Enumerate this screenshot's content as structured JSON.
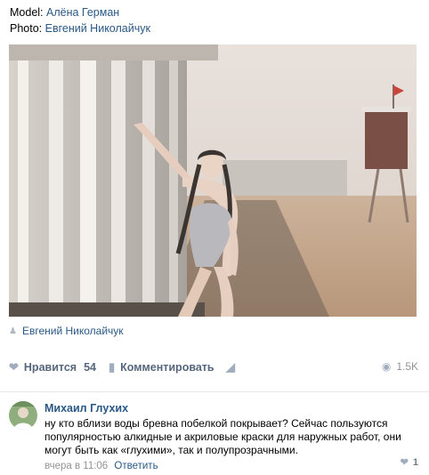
{
  "caption": {
    "model_label": "Model:",
    "model_value": "Алёна Герман",
    "photo_label": "Photo:",
    "photo_value": "Евгений Николайчук"
  },
  "photo_author": "Евгений Николайчук",
  "actions": {
    "like_label": "Нравится",
    "like_count": "54",
    "comment_label": "Комментировать",
    "views": "1.5K"
  },
  "comment": {
    "author": "Михаил Глухих",
    "text": "ну кто вблизи воды бревна побелкой покрывает? Сейчас пользуются популярностью алкидные и акриловые краски для наружных работ, они могут быть как «глухими», так и полупрозрачными.",
    "time": "вчера в 11:06",
    "reply_label": "Ответить",
    "likes": "1"
  },
  "colors": {
    "link": "#2a5885",
    "muted": "#939393",
    "icon": "#a0adbd"
  },
  "icons": [
    "person-icon",
    "heart-icon",
    "comment-icon",
    "share-megaphone-icon",
    "eye-icon"
  ]
}
